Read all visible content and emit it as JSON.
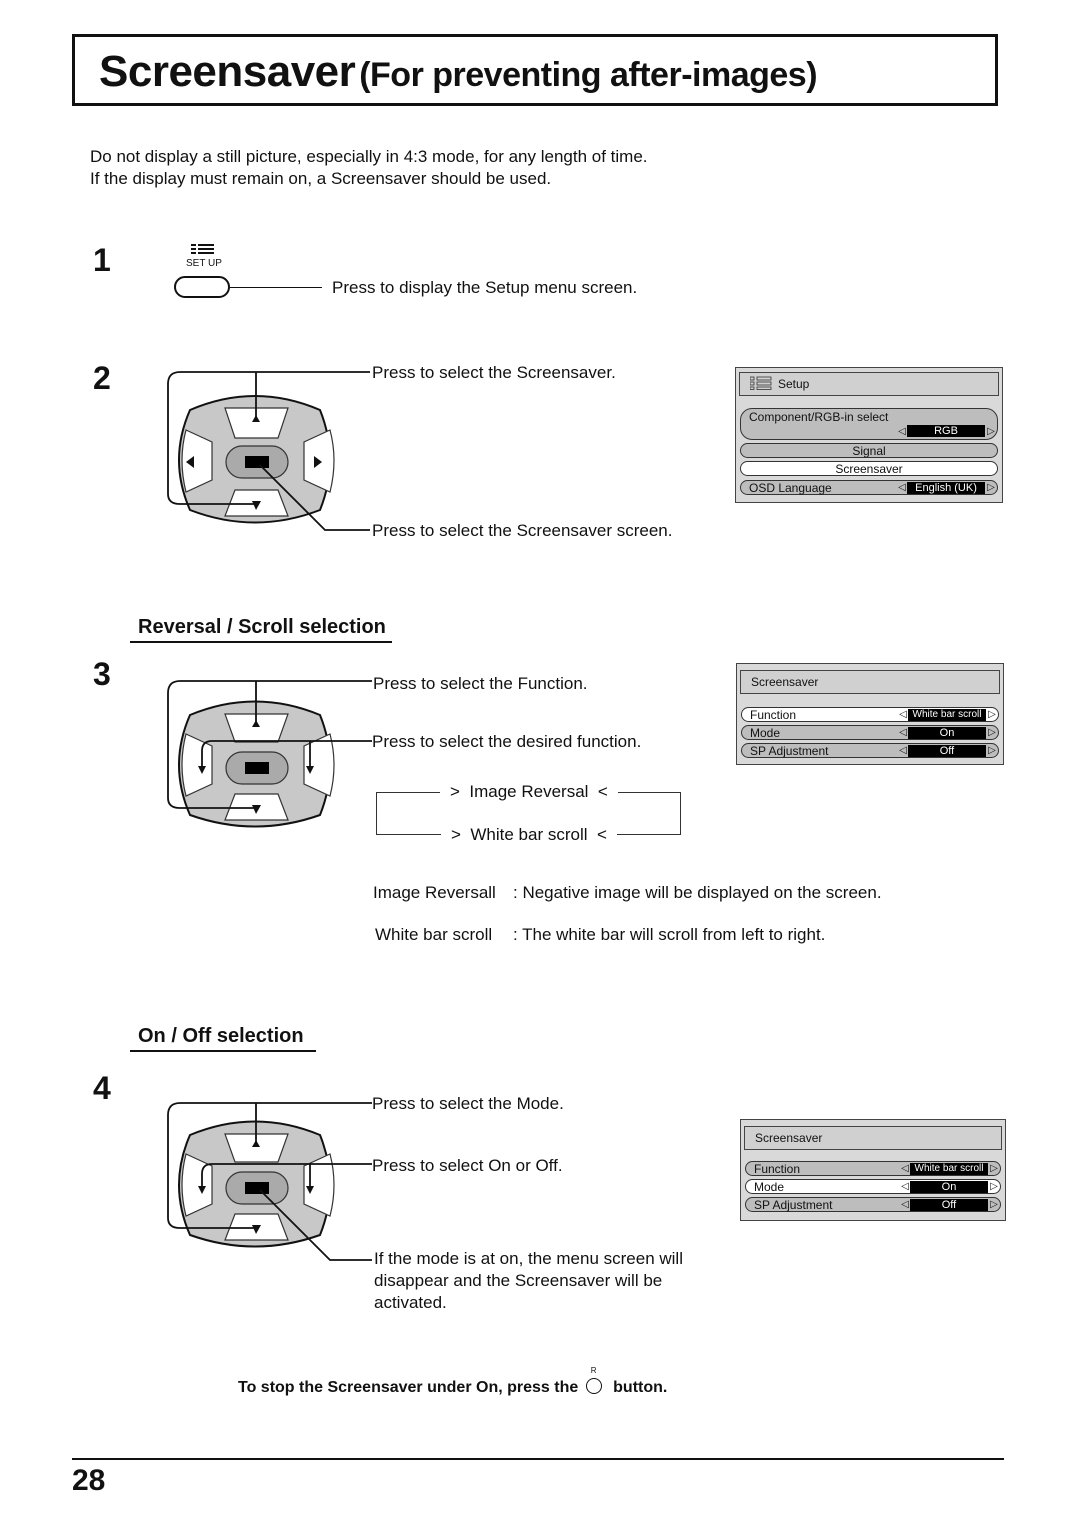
{
  "page": {
    "title_main": "Screensaver",
    "title_sub": "(For preventing after-images)",
    "intro": [
      "Do not display a still picture, especially in 4:3 mode, for any length of time.",
      "If the display must remain on, a Screensaver should be used."
    ],
    "page_number": "28"
  },
  "steps": [
    {
      "number": "1",
      "button_label": "SET UP",
      "button_icon": "setup-menu-icon",
      "callouts": [
        "Press to display the Setup menu screen."
      ]
    },
    {
      "number": "2",
      "callouts": [
        "Press to select the Screensaver.",
        "Press to select the Screensaver screen."
      ]
    },
    {
      "number": "3",
      "section_heading": "Reversal / Scroll selection",
      "callouts": [
        "Press to select the Function.",
        "Press to select the desired function."
      ],
      "cycle": [
        "Image Reversal",
        "White bar scroll"
      ],
      "definitions": [
        {
          "term": "Image Reversall",
          "desc": ": Negative image will be displayed on the screen."
        },
        {
          "term": "White bar scroll",
          "desc": ": The white bar will scroll from left to right."
        }
      ]
    },
    {
      "number": "4",
      "section_heading": "On / Off selection",
      "callouts": [
        "Press to select the Mode.",
        "Press to select On or Off.",
        "If the mode is at on, the menu screen will",
        "disappear and the Screensaver will be",
        "activated."
      ]
    }
  ],
  "osd_setup": {
    "title": "Setup",
    "title_icon": "setup-menu-icon",
    "rows": [
      {
        "label": "Component/RGB-in select",
        "value": "RGB",
        "selected": false
      },
      {
        "label": "Signal",
        "selected": false
      },
      {
        "label": "Screensaver",
        "selected": true
      },
      {
        "label": "OSD  Language",
        "value": "English (UK)",
        "selected": false
      }
    ]
  },
  "osd_screensaver_function": {
    "title": "Screensaver",
    "rows": [
      {
        "label": "Function",
        "value": "White bar scroll",
        "selected": true
      },
      {
        "label": "Mode",
        "value": "On",
        "selected": false
      },
      {
        "label": "SP Adjustment",
        "value": "Off",
        "selected": false
      }
    ]
  },
  "osd_screensaver_mode": {
    "title": "Screensaver",
    "rows": [
      {
        "label": "Function",
        "value": "White bar scroll",
        "selected": false
      },
      {
        "label": "Mode",
        "value": "On",
        "selected": true
      },
      {
        "label": "SP Adjustment",
        "value": "Off",
        "selected": false
      }
    ]
  },
  "footer_note": {
    "before": "To stop the Screensaver under On, press the",
    "button_letter": "R",
    "after": "button."
  },
  "arrows": {
    "left": "◁",
    "right": "▷"
  }
}
